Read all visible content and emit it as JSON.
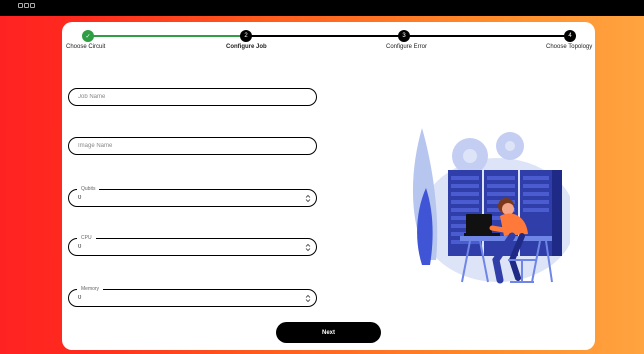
{
  "app": {
    "brand_icon": "app-logo-icon"
  },
  "colors": {
    "accent_gradient_start": "#ff2222",
    "accent_gradient_end": "#ffa440",
    "step_done": "#2f9e44",
    "step_active": "#000000",
    "button_bg": "#000000"
  },
  "stepper": {
    "steps": [
      {
        "label": "Choose Circuit",
        "icon": "check",
        "state": "done"
      },
      {
        "label": "Configure Job",
        "icon": "2",
        "state": "active"
      },
      {
        "label": "Configure Error",
        "icon": "3",
        "state": "pending"
      },
      {
        "label": "Choose Topology",
        "icon": "4",
        "state": "pending"
      }
    ]
  },
  "form": {
    "job_name": {
      "placeholder": "Job Name",
      "value": ""
    },
    "image_name": {
      "placeholder": "Image Name",
      "value": ""
    },
    "qubits": {
      "label": "Qubits",
      "value": "0"
    },
    "cpu": {
      "label": "CPU",
      "value": "0"
    },
    "memory": {
      "label": "Memory",
      "value": "0"
    }
  },
  "actions": {
    "next_label": "Next"
  },
  "illustration": {
    "name": "server-room-illustration"
  }
}
